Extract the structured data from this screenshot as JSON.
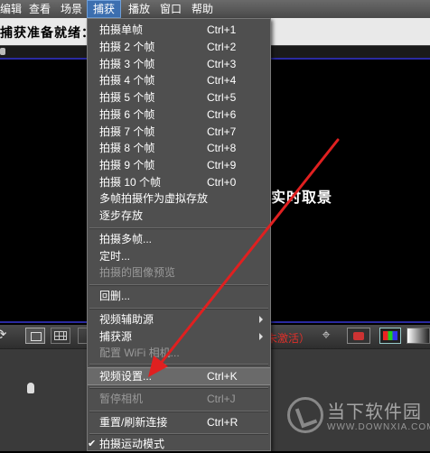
{
  "menubar": {
    "items": [
      "编辑",
      "查看",
      "场景",
      "捕获",
      "播放",
      "窗口",
      "帮助"
    ],
    "active": "捕获"
  },
  "status": {
    "ready_text": "捕获准备就绪："
  },
  "preview": {
    "live_text": "实时取景"
  },
  "toolbar": {
    "red_text": "未激活）"
  },
  "capture_menu": {
    "items": [
      {
        "label": "拍摄单帧",
        "shortcut": "Ctrl+1",
        "enabled": true
      },
      {
        "label": "拍摄 2 个帧",
        "shortcut": "Ctrl+2",
        "enabled": true
      },
      {
        "label": "拍摄 3 个帧",
        "shortcut": "Ctrl+3",
        "enabled": true
      },
      {
        "label": "拍摄 4 个帧",
        "shortcut": "Ctrl+4",
        "enabled": true
      },
      {
        "label": "拍摄 5 个帧",
        "shortcut": "Ctrl+5",
        "enabled": true
      },
      {
        "label": "拍摄 6 个帧",
        "shortcut": "Ctrl+6",
        "enabled": true
      },
      {
        "label": "拍摄 7 个帧",
        "shortcut": "Ctrl+7",
        "enabled": true
      },
      {
        "label": "拍摄 8 个帧",
        "shortcut": "Ctrl+8",
        "enabled": true
      },
      {
        "label": "拍摄 9 个帧",
        "shortcut": "Ctrl+9",
        "enabled": true
      },
      {
        "label": "拍摄 10 个帧",
        "shortcut": "Ctrl+0",
        "enabled": true
      },
      {
        "label": "多帧拍摄作为虚拟存放",
        "shortcut": "",
        "enabled": true
      },
      {
        "label": "逐步存放",
        "shortcut": "",
        "enabled": true
      },
      {
        "label": "拍摄多帧...",
        "shortcut": "",
        "enabled": true
      },
      {
        "label": "定时...",
        "shortcut": "",
        "enabled": true
      },
      {
        "label": "拍摄的图像预览",
        "shortcut": "",
        "enabled": false
      },
      {
        "label": "回删...",
        "shortcut": "",
        "enabled": true
      },
      {
        "label": "视频辅助源",
        "shortcut": "",
        "enabled": true,
        "submenu": true
      },
      {
        "label": "捕获源",
        "shortcut": "",
        "enabled": true,
        "submenu": true
      },
      {
        "label": "配置 WiFi 相机...",
        "shortcut": "",
        "enabled": false
      },
      {
        "label": "视频设置...",
        "shortcut": "Ctrl+K",
        "enabled": true,
        "highlighted": true
      },
      {
        "label": "暂停相机",
        "shortcut": "Ctrl+J",
        "enabled": false
      },
      {
        "label": "重置/刷新连接",
        "shortcut": "Ctrl+R",
        "enabled": true
      },
      {
        "label": "拍摄运动模式",
        "shortcut": "",
        "enabled": true,
        "checked": true
      }
    ]
  },
  "watermark": {
    "name": "当下软件园",
    "url": "WWW.DOWNXIA.COM"
  },
  "colors": {
    "annotation_arrow": "#e02020",
    "menu_highlight": "#3c6fb0"
  }
}
